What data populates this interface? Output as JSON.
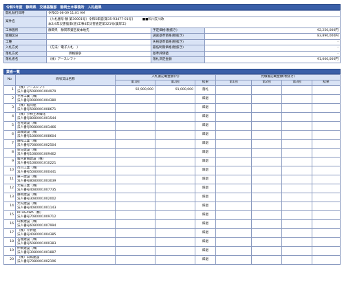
{
  "title": "令和5年度　静岡県　交通基盤部　静岡土木事務所　入札結果",
  "info": {
    "rows": [
      {
        "label": "開札執行日時",
        "value": "令和05-06-09 11:01 AM"
      },
      {
        "label": "案件名",
        "value_line1": "（入札番号-静 第30001号）令和5年度[第35-R3477-01号]　　　■■料川支川改",
        "value_line2": "本2/4年災害復旧(道)工事4年災害査定第321号(廣岸工)"
      },
      {
        "label": "工事箇所",
        "value": "静岡県　静岡市葵区坂本地先",
        "label2": "予定価格(税抜き)",
        "value2": "92,250,000円"
      },
      {
        "label": "組織区分",
        "value": "",
        "label2": "調査基準価格(税抜き)",
        "value2": "83,890,000円"
      },
      {
        "label": "工種",
        "value": "",
        "label2": "失格基準価格(税抜き)",
        "value2": "-"
      },
      {
        "label": "入札方式",
        "value": "（方法：電子入札　）",
        "label2": "最低制限価格(税抜き)",
        "value2": "-"
      },
      {
        "label": "落札方式",
        "value": "価格競争",
        "label2": "基準評価値",
        "value2": "-"
      },
      {
        "label": "落札者名",
        "value": "（株）アースシフト",
        "label2": "落札決定金額",
        "value2": "91,000,000円"
      }
    ]
  },
  "list": {
    "section_title": "業者一覧",
    "headers": {
      "no": "No",
      "name": "商号又は名称",
      "bid_group": "入札書記載金額(円)",
      "comp_group": "見積書記載金額(税抜き)",
      "round1": "第1回",
      "round2": "第2回",
      "round3": "第3回",
      "result": "結果"
    },
    "rows": [
      {
        "no": "1",
        "name": "（株）アースシフト",
        "reg": "法人番号5080001004979",
        "r1": "92,900,000",
        "r2": "91,000,000",
        "res": "落札"
      },
      {
        "no": "2",
        "name": "平井工業（株）",
        "reg": "法人番号9080001004380",
        "r1": "",
        "r2": "",
        "res": "辞退"
      },
      {
        "no": "3",
        "name": "（株）稲川組",
        "reg": "法人番号5080001008671",
        "r1": "",
        "r2": "",
        "res": "辞退"
      },
      {
        "no": "4",
        "name": "（株）小林土木緑化",
        "reg": "法人番号8080001001544",
        "r1": "",
        "r2": "",
        "res": "辞退"
      },
      {
        "no": "5",
        "name": "石光建設（株）",
        "reg": "法人番号9080001001466",
        "r1": "",
        "r2": "",
        "res": "辞退"
      },
      {
        "no": "6",
        "name": "高橋建設（株）",
        "reg": "法人番号1080001008604",
        "r1": "",
        "r2": "",
        "res": "辞退"
      },
      {
        "no": "7",
        "name": "静和工業（株）",
        "reg": "法人番号7080001002504",
        "r1": "",
        "r2": "",
        "res": "辞退"
      },
      {
        "no": "8",
        "name": "鈴与建設（株）",
        "reg": "法人番号1080001009462",
        "r1": "",
        "r2": "",
        "res": "辞退"
      },
      {
        "no": "9",
        "name": "駿河倉橋建設（株）",
        "reg": "法人番号1080001010221",
        "r1": "",
        "r2": "",
        "res": "辞退"
      },
      {
        "no": "10",
        "name": "市川工業（株）",
        "reg": "法人番号5080001000441",
        "r1": "",
        "r2": "",
        "res": "辞退"
      },
      {
        "no": "11",
        "name": "東一建設（株）",
        "reg": "法人番号8080001003039",
        "r1": "",
        "r2": "",
        "res": "辞退"
      },
      {
        "no": "12",
        "name": "大場工業（株）",
        "reg": "法人番号4080001007735",
        "r1": "",
        "r2": "",
        "res": "辞退"
      },
      {
        "no": "13",
        "name": "静岡建設（株）",
        "reg": "法人番号3080001002002",
        "r1": "",
        "r2": "",
        "res": "辞退"
      },
      {
        "no": "14",
        "name": "大内建設（株）",
        "reg": "法人番号4080001001143",
        "r1": "",
        "r2": "",
        "res": "辞退"
      },
      {
        "no": "15",
        "name": "KITAGAWA（株）",
        "reg": "法人番号7080001009712",
        "r1": "",
        "r2": "",
        "res": "辞退"
      },
      {
        "no": "16",
        "name": "山梨建設（株）",
        "reg": "法人番号6080001007994",
        "r1": "",
        "r2": "",
        "res": "辞退"
      },
      {
        "no": "17",
        "name": "（株）平井組",
        "reg": "法人番号4080001004385",
        "r1": "",
        "r2": "",
        "res": "辞退"
      },
      {
        "no": "18",
        "name": "石福建設（株）",
        "reg": "法人番号5080001000383",
        "r1": "",
        "r2": "",
        "res": "辞退"
      },
      {
        "no": "19",
        "name": "伸栄建設（株）",
        "reg": "法人番号3080001001887",
        "r1": "",
        "r2": "",
        "res": "辞退"
      },
      {
        "no": "20",
        "name": "（株）白鳥建設",
        "reg": "法人番号7080001002196",
        "r1": "",
        "r2": "",
        "res": "辞退"
      }
    ]
  }
}
